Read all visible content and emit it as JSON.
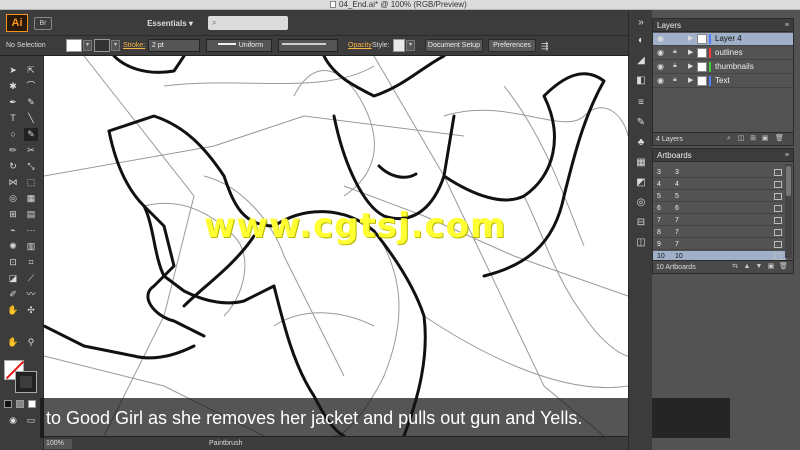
{
  "window": {
    "title": "04_End.ai* @ 100% (RGB/Preview)"
  },
  "appbar": {
    "logo": "Ai",
    "bridge_label": "Br",
    "workspace": "Essentials",
    "search_icon": "search-icon"
  },
  "controlbar": {
    "selection": "No Selection",
    "stroke_label": "Stroke:",
    "stroke_weight": "2 pt",
    "profile": "Uniform",
    "opacity_label": "Opacity",
    "style_label": "Style:",
    "document_setup": "Document Setup",
    "preferences": "Preferences"
  },
  "canvas": {
    "watermark": "www.cgtsj.com",
    "subtitle": "to Good Girl as she removes her jacket and pulls out gun and Yells."
  },
  "statusbar": {
    "zoom": "100%",
    "tool": "Paintbrush"
  },
  "layers": {
    "title": "Layers",
    "items": [
      {
        "name": "Layer 4",
        "color": "#4f7fff",
        "selected": true
      },
      {
        "name": "outlines",
        "color": "#ff3b3b",
        "selected": false
      },
      {
        "name": "thumbnails",
        "color": "#3bd13b",
        "selected": false
      },
      {
        "name": "Text",
        "color": "#4f7fff",
        "selected": false
      }
    ],
    "count": "4 Layers"
  },
  "artboards": {
    "title": "Artboards",
    "rows": [
      {
        "num": "3",
        "name": "3"
      },
      {
        "num": "4",
        "name": "4"
      },
      {
        "num": "5",
        "name": "5"
      },
      {
        "num": "6",
        "name": "6"
      },
      {
        "num": "7",
        "name": "7"
      },
      {
        "num": "8",
        "name": "7"
      },
      {
        "num": "9",
        "name": "7"
      },
      {
        "num": "10",
        "name": "10",
        "selected": true
      }
    ],
    "count": "10 Artboards"
  },
  "colors": {
    "accent": "#f7941d",
    "selection": "#9fb0c8",
    "watermark": "#ffff33"
  }
}
